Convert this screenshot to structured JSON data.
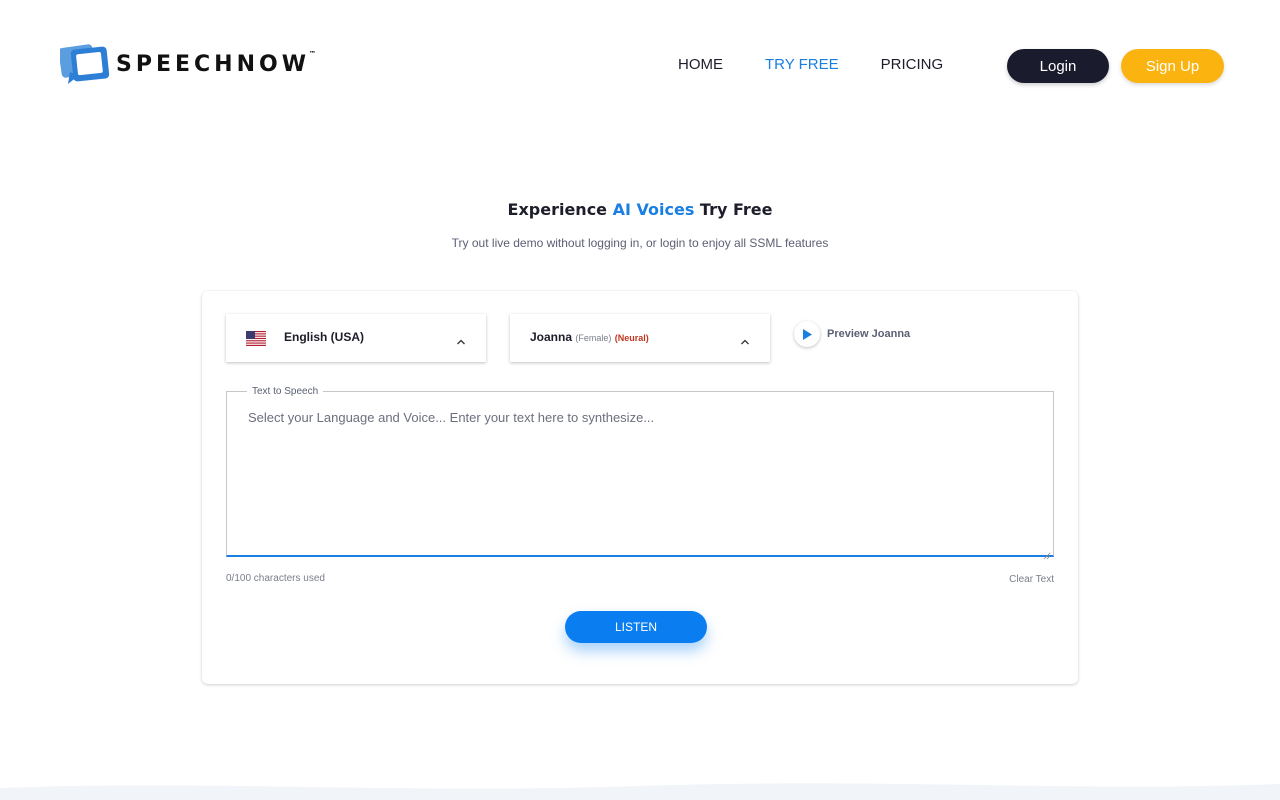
{
  "brand": {
    "name": "SPEECHNOW",
    "tm": "™"
  },
  "nav": {
    "home": "HOME",
    "try_free": "TRY FREE",
    "pricing": "PRICING"
  },
  "auth": {
    "login": "Login",
    "signup": "Sign Up"
  },
  "hero": {
    "title_prefix": "Experience ",
    "title_accent": "AI Voices",
    "title_suffix": " Try Free",
    "subtitle": "Try out live demo without logging in, or login to enjoy all SSML features"
  },
  "demo": {
    "language": "English (USA)",
    "voice": {
      "name": "Joanna",
      "gender": "(Female)",
      "engine": "(Neural)"
    },
    "preview_label": "Preview Joanna",
    "tts_legend": "Text to Speech",
    "tts_placeholder": "Select your Language and Voice... Enter your text here to synthesize...",
    "tts_value": "",
    "char_count": "0/100 characters used",
    "clear_text": "Clear Text",
    "listen": "LISTEN"
  },
  "colors": {
    "accent": "#1a7fe0",
    "dark": "#1b1b2e",
    "signup": "#fbb310",
    "neural": "#c0361e"
  },
  "icons": {
    "logo": "speech-bubble-logo-icon",
    "flag": "us-flag-icon",
    "chevron": "chevron-up-icon",
    "play": "play-icon"
  }
}
